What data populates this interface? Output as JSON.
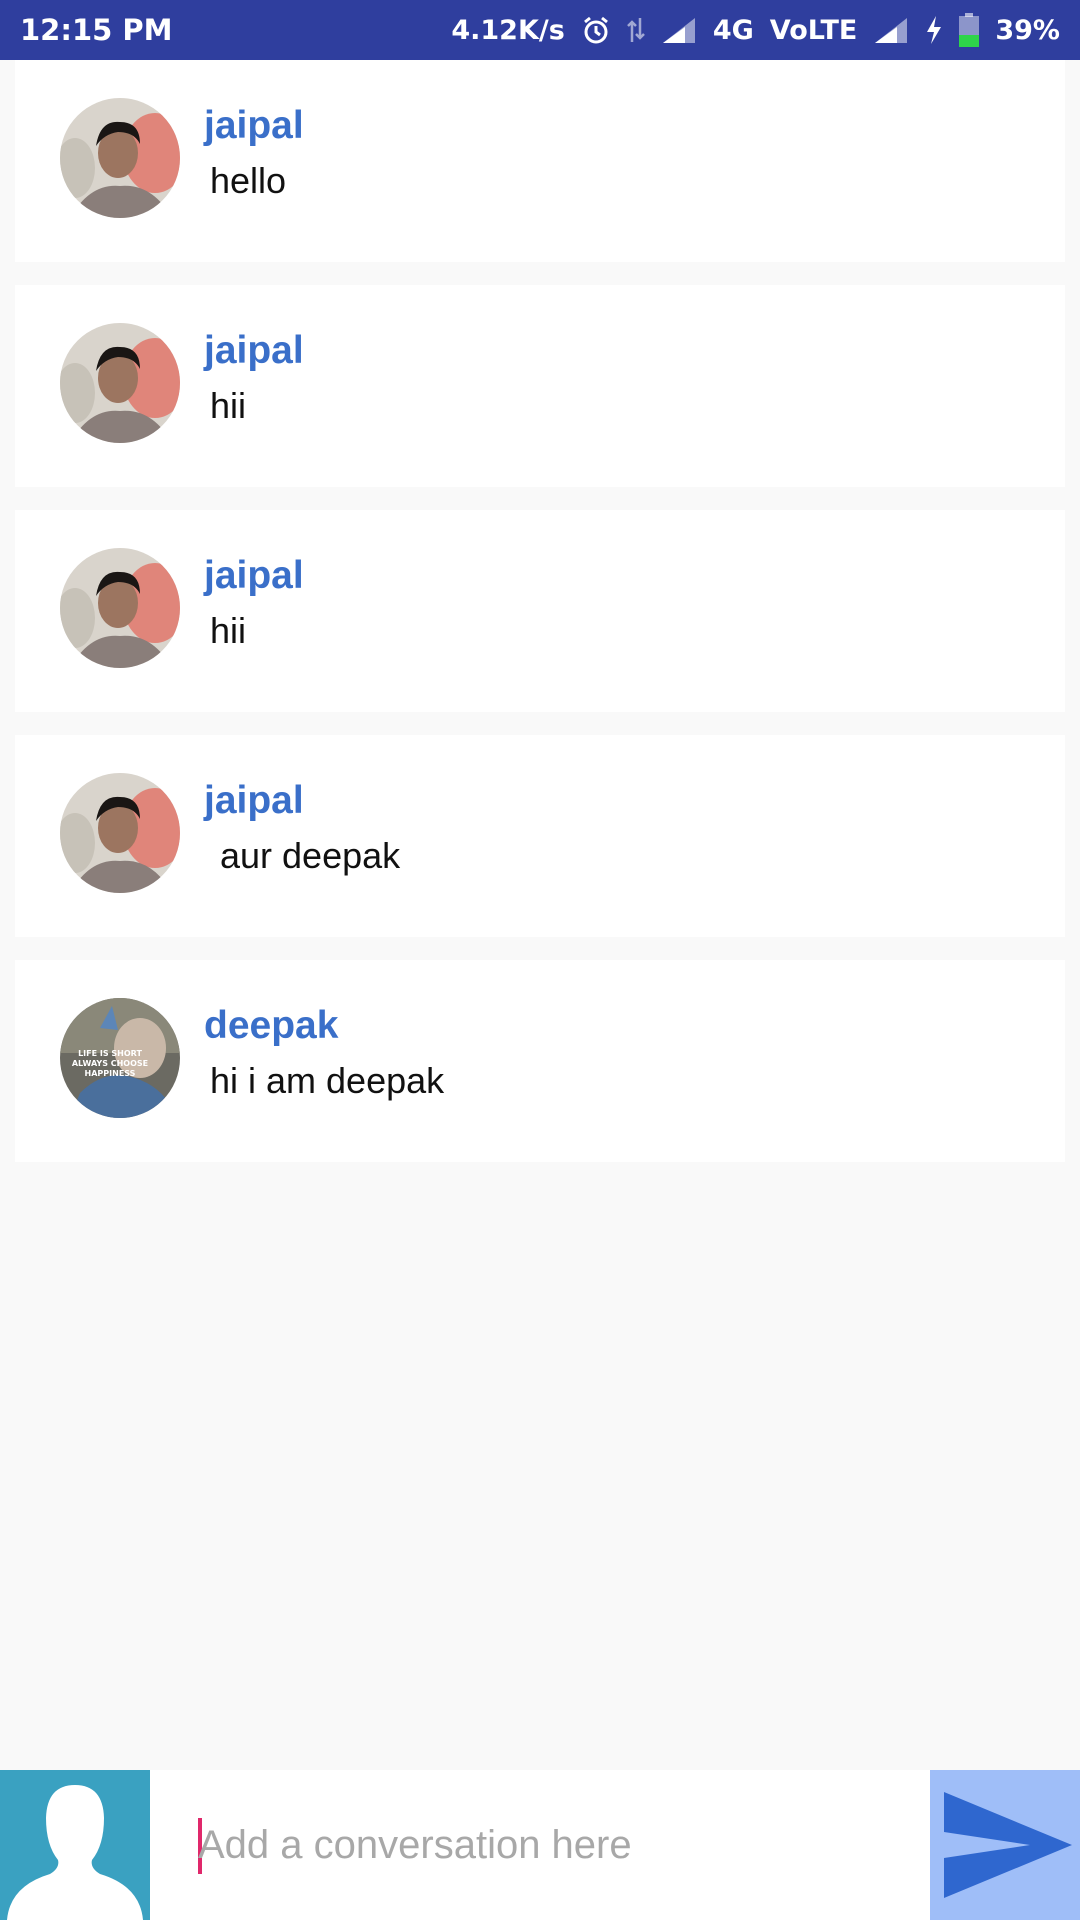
{
  "status_bar": {
    "time": "12:15 PM",
    "network_speed": "4.12K/s",
    "network_type": "4G",
    "volte": "VoLTE",
    "battery_percent": "39%",
    "battery_level": 0.39,
    "icons": [
      "alarm-icon",
      "data-arrows-icon",
      "signal-icon",
      "signal-icon-2",
      "charging-icon",
      "battery-icon"
    ]
  },
  "messages": [
    {
      "sender": "jaipal",
      "text": "hello",
      "avatar": "jaipal-avatar"
    },
    {
      "sender": "jaipal",
      "text": "hii",
      "avatar": "jaipal-avatar"
    },
    {
      "sender": "jaipal",
      "text": "hii",
      "avatar": "jaipal-avatar"
    },
    {
      "sender": "jaipal",
      "text": " aur deepak",
      "avatar": "jaipal-avatar"
    },
    {
      "sender": "deepak",
      "text": "hi i am deepak",
      "avatar": "deepak-avatar"
    }
  ],
  "deepak_avatar_text": [
    "LIFE IS SHORT",
    "ALWAYS CHOOSE",
    "HAPPINESS"
  ],
  "compose": {
    "placeholder": "Add a conversation here",
    "value": ""
  },
  "colors": {
    "status_bar": "#2f3e9e",
    "sender_name": "#3a6fc9",
    "user_avatar_bg": "#3aa1c1",
    "send_button_bg": "#9fbef8",
    "send_icon": "#2f67cf",
    "caret": "#e0286b"
  }
}
